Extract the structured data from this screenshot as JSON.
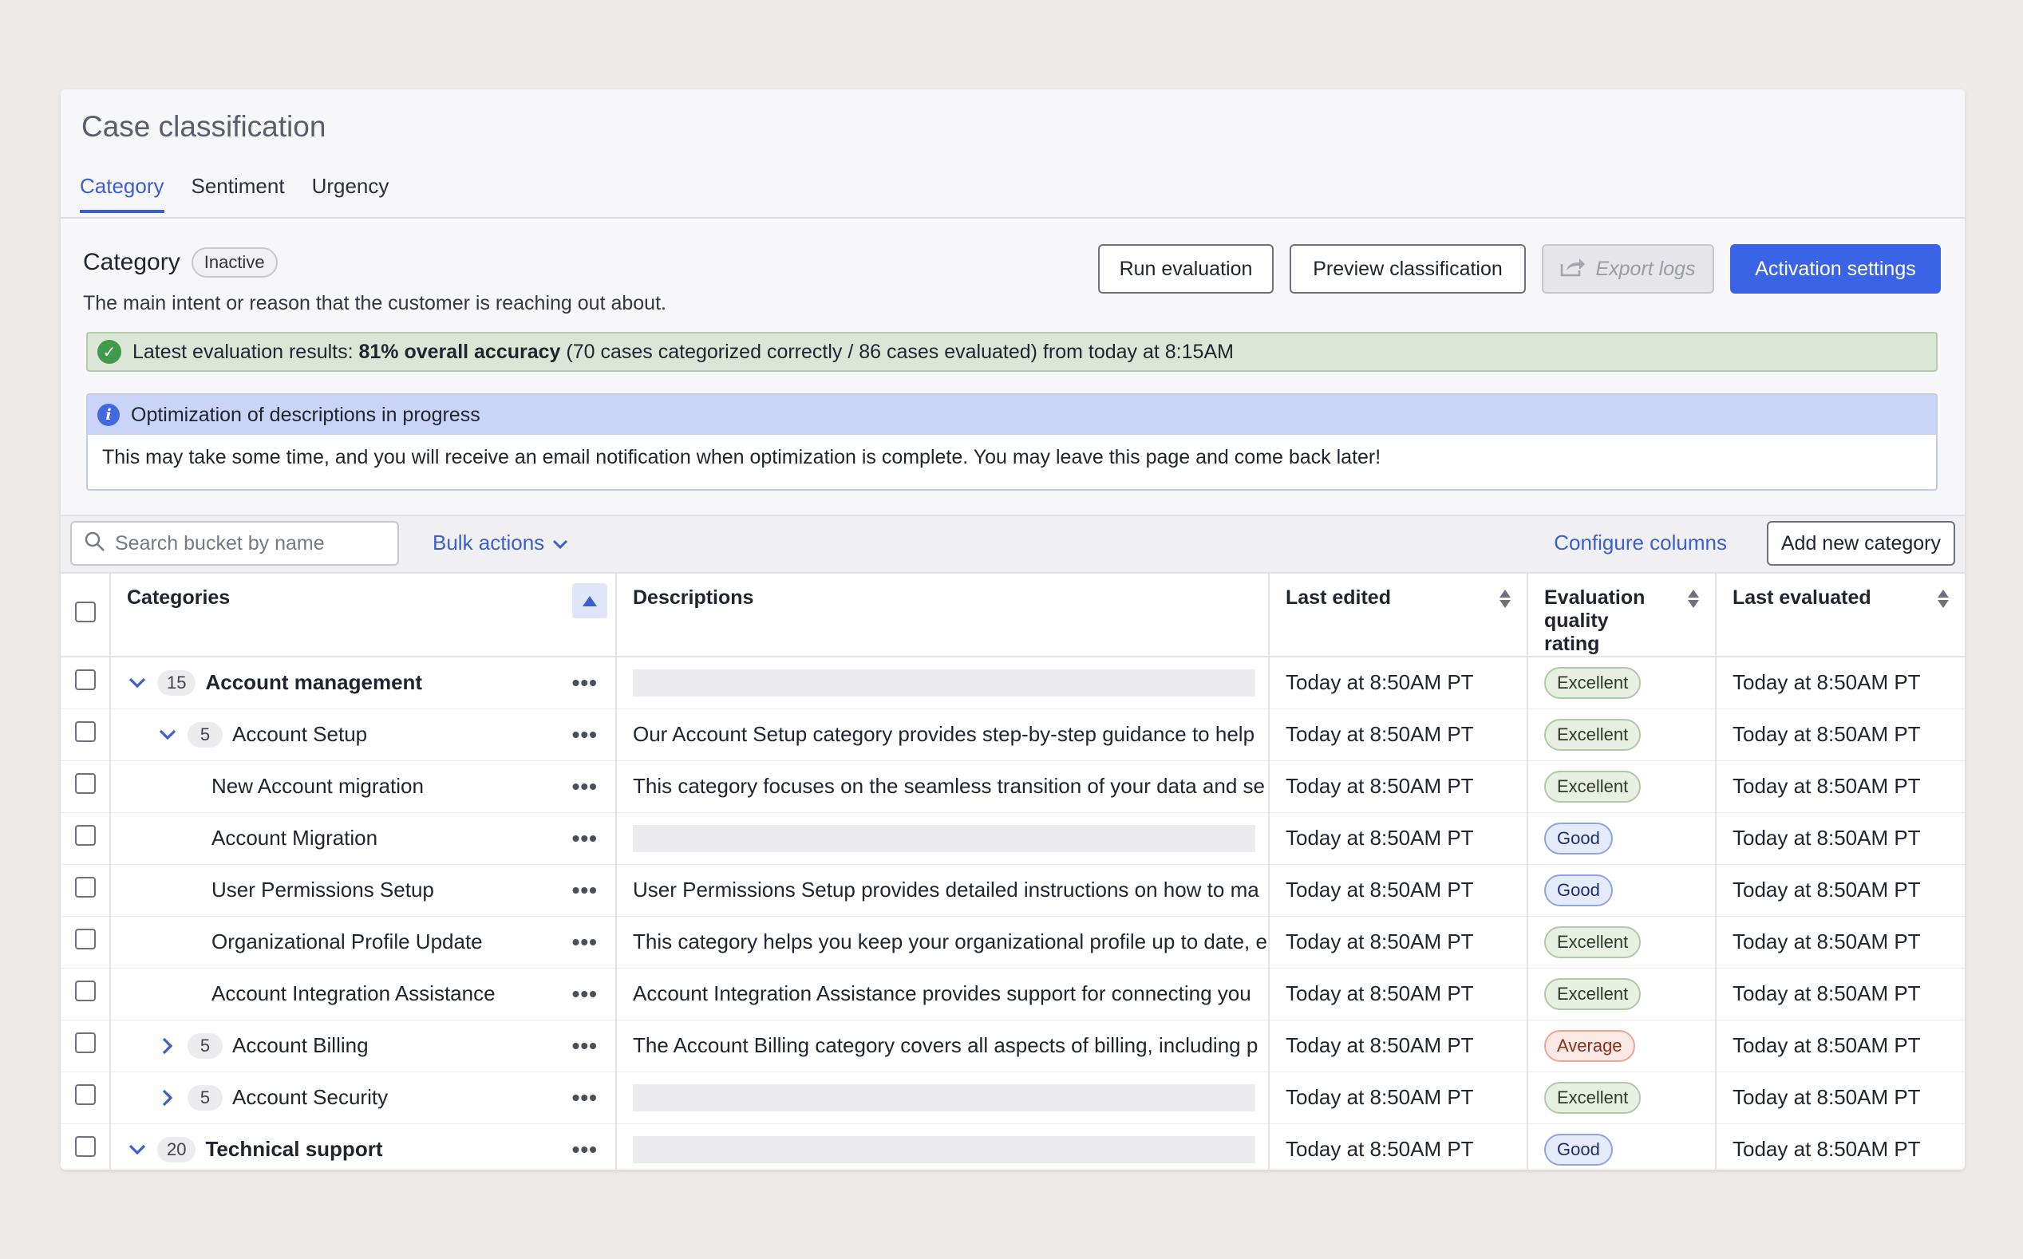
{
  "page": {
    "title": "Case classification"
  },
  "tabs": [
    {
      "label": "Category",
      "active": true
    },
    {
      "label": "Sentiment",
      "active": false
    },
    {
      "label": "Urgency",
      "active": false
    }
  ],
  "section": {
    "title": "Category",
    "status_badge": "Inactive",
    "description": "The main intent or reason that the customer is reaching out about.",
    "buttons": {
      "run_evaluation": "Run evaluation",
      "preview_classification": "Preview classification",
      "export_logs": "Export logs",
      "activation_settings": "Activation settings"
    }
  },
  "evaluation_alert": {
    "prefix": "Latest evaluation results: ",
    "highlight": "81% overall accuracy",
    "suffix": " (70 cases categorized correctly / 86 cases evaluated) from today at 8:15AM"
  },
  "info_alert": {
    "title": "Optimization of descriptions in progress",
    "body": "This may take some time, and you will receive an email notification when optimization is complete. You may leave this page and come back later!"
  },
  "toolbar": {
    "search_placeholder": "Search bucket by name",
    "bulk_actions": "Bulk actions",
    "configure_columns": "Configure columns",
    "add_new_category": "Add new category"
  },
  "table": {
    "headers": {
      "categories": "Categories",
      "descriptions": "Descriptions",
      "last_edited": "Last edited",
      "evaluation_quality_rating": "Evaluation quality rating",
      "last_evaluated": "Last evaluated"
    },
    "rows": [
      {
        "level": 0,
        "expand": "down",
        "count": "15",
        "name": "Account management",
        "description": "",
        "last_edited": "Today at 8:50AM PT",
        "rating": "Excellent",
        "last_evaluated": "Today at 8:50AM PT"
      },
      {
        "level": 1,
        "expand": "down",
        "count": "5",
        "name": "Account Setup",
        "description": "Our Account Setup category provides step-by-step guidance to help",
        "last_edited": "Today at 8:50AM PT",
        "rating": "Excellent",
        "last_evaluated": "Today at 8:50AM PT"
      },
      {
        "level": 2,
        "expand": "",
        "count": "",
        "name": "New Account migration",
        "description": "This category focuses on the seamless transition of your data and se",
        "last_edited": "Today at 8:50AM PT",
        "rating": "Excellent",
        "last_evaluated": "Today at 8:50AM PT"
      },
      {
        "level": 2,
        "expand": "",
        "count": "",
        "name": "Account Migration",
        "description": "",
        "last_edited": "Today at 8:50AM PT",
        "rating": "Good",
        "last_evaluated": "Today at 8:50AM PT"
      },
      {
        "level": 2,
        "expand": "",
        "count": "",
        "name": "User Permissions Setup",
        "description": "User Permissions Setup provides detailed instructions on how to ma",
        "last_edited": "Today at 8:50AM PT",
        "rating": "Good",
        "last_evaluated": "Today at 8:50AM PT"
      },
      {
        "level": 2,
        "expand": "",
        "count": "",
        "name": "Organizational Profile Update",
        "description": "This category helps you keep your organizational profile up to date, e",
        "last_edited": "Today at 8:50AM PT",
        "rating": "Excellent",
        "last_evaluated": "Today at 8:50AM PT"
      },
      {
        "level": 2,
        "expand": "",
        "count": "",
        "name": "Account Integration Assistance",
        "description": "Account Integration Assistance provides support for connecting you",
        "last_edited": "Today at 8:50AM PT",
        "rating": "Excellent",
        "last_evaluated": "Today at 8:50AM PT"
      },
      {
        "level": 1,
        "expand": "right",
        "count": "5",
        "name": "Account Billing",
        "description": "The Account Billing category covers all aspects of billing, including p",
        "last_edited": "Today at 8:50AM PT",
        "rating": "Average",
        "last_evaluated": "Today at 8:50AM PT"
      },
      {
        "level": 1,
        "expand": "right",
        "count": "5",
        "name": "Account Security",
        "description": "",
        "last_edited": "Today at 8:50AM PT",
        "rating": "Excellent",
        "last_evaluated": "Today at 8:50AM PT"
      },
      {
        "level": 0,
        "expand": "down",
        "count": "20",
        "name": "Technical support",
        "description": "",
        "last_edited": "Today at 8:50AM PT",
        "rating": "Good",
        "last_evaluated": "Today at 8:50AM PT"
      }
    ]
  },
  "colors": {
    "accent": "#3b5fd0",
    "primary_button": "#3b63e6",
    "success_bg": "#dce6d7",
    "info_bg": "#c9d4f7"
  }
}
